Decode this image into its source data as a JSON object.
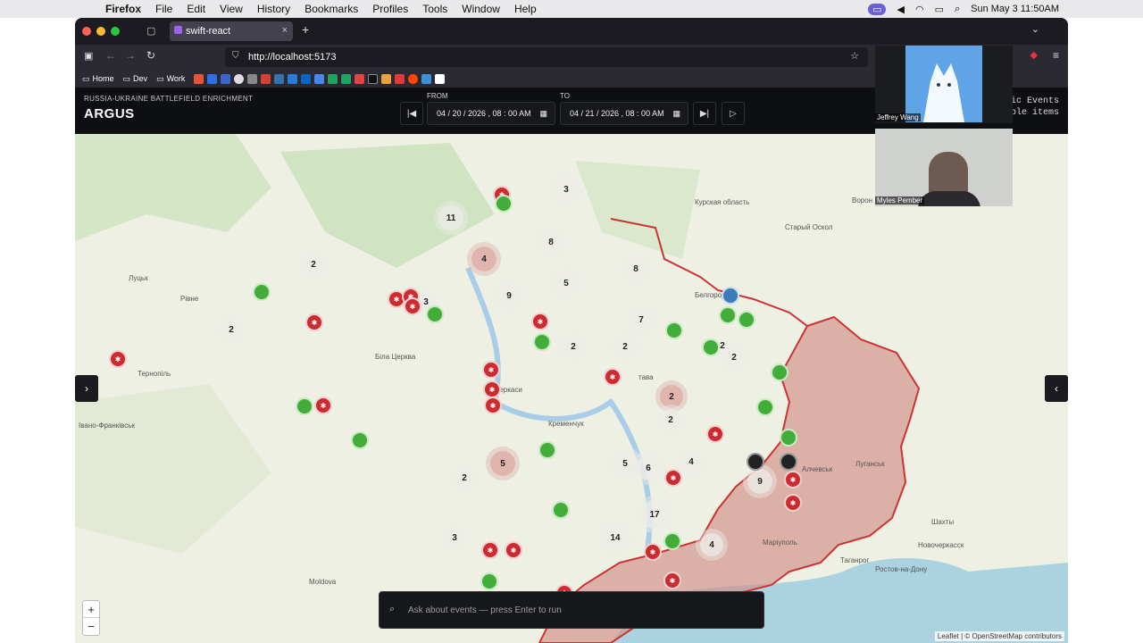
{
  "menubar": {
    "app": "Firefox",
    "items": [
      "File",
      "Edit",
      "View",
      "History",
      "Bookmarks",
      "Profiles",
      "Tools",
      "Window",
      "Help"
    ],
    "datetime": "Sun May 3  11:50AM"
  },
  "browser": {
    "tab_title": "swift-react",
    "url": "http://localhost:5173",
    "bookmarks": [
      "Home",
      "Dev",
      "Work"
    ]
  },
  "app": {
    "subtitle": "RUSSIA-UKRAINE BATTLEFIELD ENRICHMENT",
    "title": "ARGUS",
    "from_label": "FROM",
    "to_label": "TO",
    "from_value": "04 / 20 / 2026 ,  08 : 00  AM",
    "to_value": "04 / 21 / 2026 ,  08 : 00  AM",
    "right_ticker_line1": "ic Events",
    "right_ticker_line2": "able items"
  },
  "map": {
    "labels": {
      "lutsk": "Луцьк",
      "rivne": "Рівне",
      "ternopil": "Тернопіль",
      "ivano": "Івано-Франківськ",
      "bila": "Біла Церква",
      "cherkasy": "Черкаси",
      "kremenchuk": "Кременчук",
      "poltava": "тава",
      "belgorod": "Белгород",
      "kursk": "Курская область",
      "luhansk": "Луганськ",
      "alchevsk": "Алчевськ",
      "mariupol": "Маріуполь",
      "taganrog": "Таганрог",
      "rostov": "Ростов-на-Дону",
      "moldova": "Moldova",
      "voronezh": "Ворон",
      "shakhty": "Шахты",
      "novocherkassk": "Новочеркасск",
      "staryi": "Старый Оскол"
    },
    "clusters": [
      "11",
      "3",
      "2",
      "8",
      "4",
      "8",
      "5",
      "9",
      "3",
      "2",
      "2",
      "7",
      "2",
      "2",
      "2",
      "2",
      "2",
      "5",
      "5",
      "6",
      "4",
      "9",
      "17",
      "14",
      "3",
      "4",
      "2"
    ],
    "ask_placeholder": "Ask about events — press Enter to run",
    "attribution": "Leaflet | © OpenStreetMap contributors",
    "zoom_in": "+",
    "zoom_out": "−"
  },
  "video": {
    "participant1": "Jeffrey Wang",
    "participant2": "Myles Pember"
  },
  "colors": {
    "occupied": "#d18d86",
    "event_red": "#cc2b30",
    "event_green": "#43ad3a"
  }
}
